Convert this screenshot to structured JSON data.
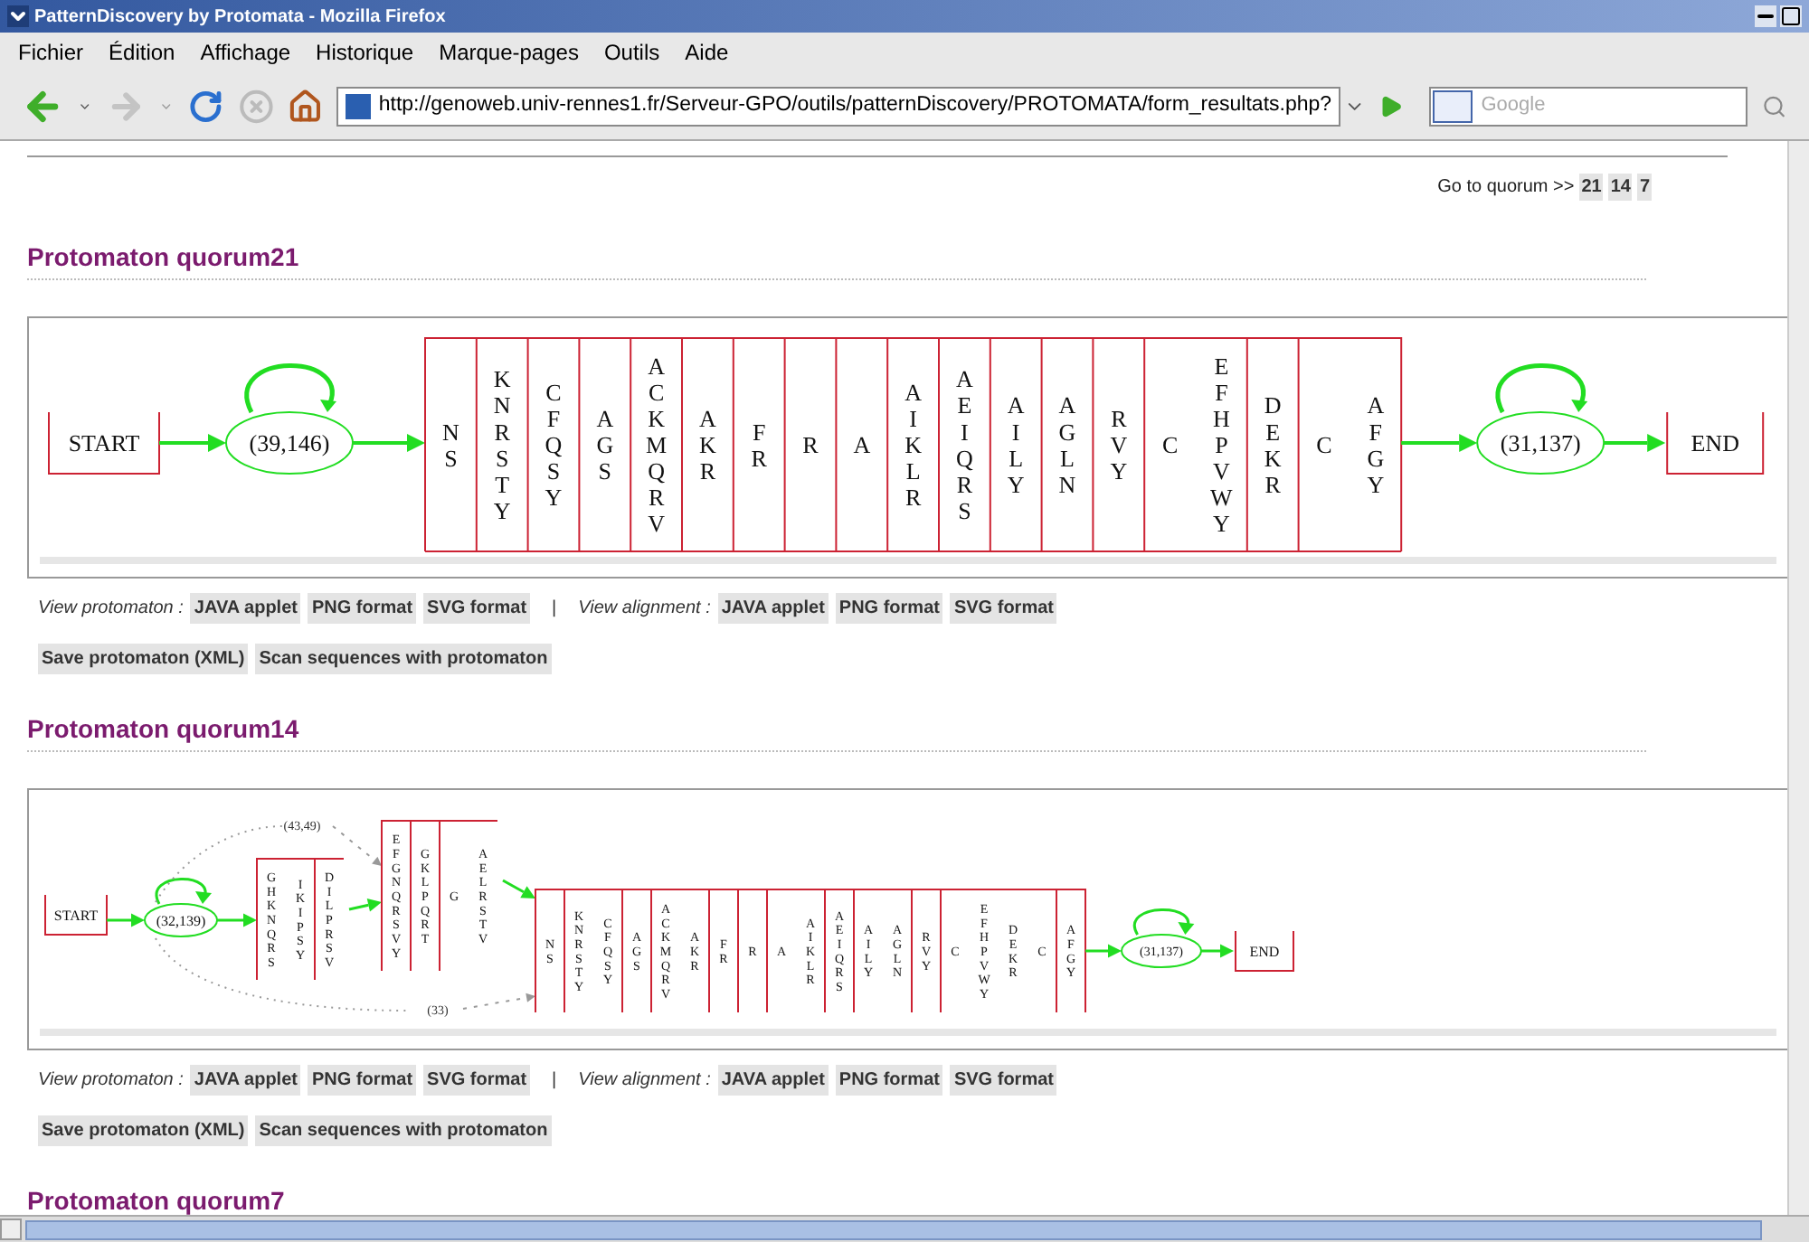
{
  "window": {
    "title": "PatternDiscovery by Protomata - Mozilla Firefox"
  },
  "menu": [
    "Fichier",
    "Édition",
    "Affichage",
    "Historique",
    "Marque-pages",
    "Outils",
    "Aide"
  ],
  "toolbar": {
    "url": "http://genoweb.univ-rennes1.fr/Serveur-GPO/outils/patternDiscovery/PROTOMATA/form_resultats.php?",
    "search_placeholder": "Google"
  },
  "quorum_nav": {
    "label": "Go to quorum >>",
    "links": [
      "21",
      "14",
      "7"
    ]
  },
  "sections": [
    {
      "title": "Protomaton quorum21",
      "diagram": {
        "kind": "linear",
        "start": "START",
        "end": "END",
        "states": [
          "(39,146)",
          "(31,137)"
        ],
        "groups": [
          [
            [
              "NS"
            ],
            [
              "KNRSTY"
            ],
            [
              "CFQSY"
            ],
            [
              "AGS"
            ],
            [
              "ACKMQRV"
            ],
            [
              "AKR"
            ],
            [
              "FR"
            ],
            [
              "R"
            ],
            [
              "A"
            ],
            [
              "AIKLR"
            ],
            [
              "AEIQRS"
            ],
            [
              "AILY"
            ],
            [
              "AGLN"
            ],
            [
              "RVY"
            ],
            [
              "C",
              "EFHPVWY"
            ],
            [
              "DEKR"
            ],
            [
              "C",
              "AFGY"
            ]
          ]
        ]
      },
      "view_protomaton_label": "View protomaton :",
      "protomaton_buttons": [
        "JAVA applet",
        "PNG format",
        "SVG format"
      ],
      "separator": "|",
      "view_alignment_label": "View alignment :",
      "alignment_buttons": [
        "JAVA applet",
        "PNG format",
        "SVG format"
      ],
      "action_buttons": [
        "Save protomaton (XML)",
        "Scan sequences with protomaton"
      ]
    },
    {
      "title": "Protomaton quorum14",
      "diagram": {
        "kind": "branched",
        "start": "START",
        "end": "END",
        "states": [
          "(32,139)",
          "(31,137)"
        ],
        "side_labels": [
          "(43,49)",
          "(33)"
        ],
        "groups": [
          [
            [
              "GHKNQRS",
              "IKIPSY"
            ],
            [
              "DILPRSV"
            ]
          ],
          [
            [
              "EFGNQRSVY"
            ],
            [
              "GKLPQRT"
            ],
            [
              "G",
              "AELRSTV"
            ]
          ],
          [
            [
              "NS"
            ],
            [
              "KNRSTY",
              "CFQSY"
            ],
            [
              "AGS"
            ],
            [
              "ACKMQRV",
              "AKR"
            ],
            [
              "FR"
            ],
            [
              "R"
            ],
            [
              "A",
              "AIKLR"
            ],
            [
              "AEIQRS"
            ],
            [
              "AILY",
              "AGLN"
            ],
            [
              "RVY"
            ],
            [
              "C",
              "EFHPVWY",
              "DEKR",
              "C"
            ],
            [
              "AFGY"
            ]
          ]
        ]
      },
      "view_protomaton_label": "View protomaton :",
      "protomaton_buttons": [
        "JAVA applet",
        "PNG format",
        "SVG format"
      ],
      "separator": "|",
      "view_alignment_label": "View alignment :",
      "alignment_buttons": [
        "JAVA applet",
        "PNG format",
        "SVG format"
      ],
      "action_buttons": [
        "Save protomaton (XML)",
        "Scan sequences with protomaton"
      ]
    },
    {
      "title": "Protomaton quorum7"
    }
  ]
}
